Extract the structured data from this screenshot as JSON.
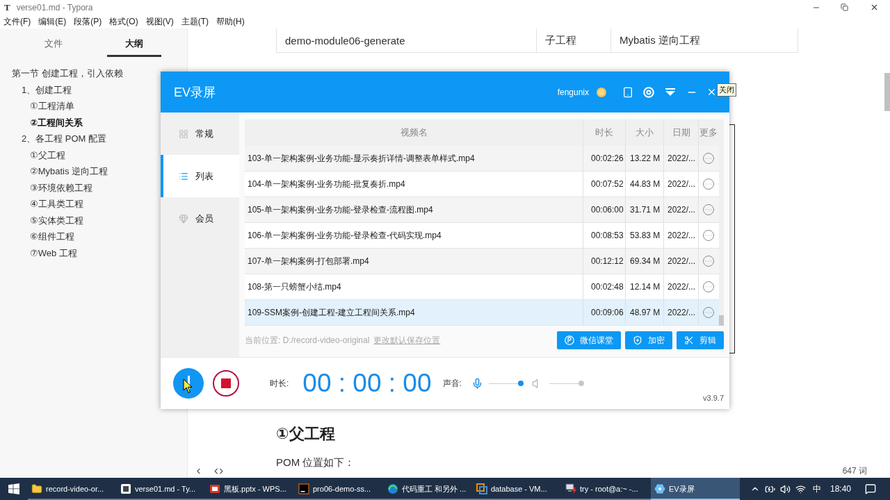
{
  "typora": {
    "app_letter": "T",
    "title": "verse01.md - Typora",
    "menu": [
      "文件(F)",
      "编辑(E)",
      "段落(P)",
      "格式(O)",
      "视图(V)",
      "主题(T)",
      "帮助(H)"
    ],
    "sidebar": {
      "tabs": [
        {
          "label": "文件",
          "selected": false
        },
        {
          "label": "大纲",
          "selected": true
        }
      ],
      "outline": [
        {
          "label": "第一节 创建工程，引入依赖",
          "selected": false,
          "children": [
            {
              "label": "1、创建工程",
              "selected": false,
              "children": [
                {
                  "label": "①工程清单",
                  "selected": false
                },
                {
                  "label": "②工程间关系",
                  "selected": true
                }
              ]
            },
            {
              "label": "2、各工程 POM 配置",
              "selected": false,
              "children": [
                {
                  "label": "①父工程",
                  "selected": false
                },
                {
                  "label": "②Mybatis 逆向工程",
                  "selected": false
                },
                {
                  "label": "③环境依赖工程",
                  "selected": false
                },
                {
                  "label": "④工具类工程",
                  "selected": false
                },
                {
                  "label": "⑤实体类工程",
                  "selected": false
                },
                {
                  "label": "⑥组件工程",
                  "selected": false
                },
                {
                  "label": "⑦Web 工程",
                  "selected": false
                }
              ]
            }
          ]
        }
      ]
    },
    "document": {
      "table_row": {
        "cells": [
          "demo-module06-generate",
          "子工程",
          "Mybatis 逆向工程"
        ]
      },
      "heading": "①父工程",
      "paragraph": "POM 位置如下："
    },
    "status_bar": {
      "word_count": "647 词"
    }
  },
  "ev_recorder": {
    "title": "EV录屏",
    "user": "fengunix",
    "close_tooltip": "关闭",
    "nav": [
      {
        "label": "常规",
        "selected": false
      },
      {
        "label": "列表",
        "selected": true
      },
      {
        "label": "会员",
        "selected": false
      }
    ],
    "table": {
      "columns": [
        "视频名",
        "时长",
        "大小",
        "日期",
        "更多"
      ],
      "rows": [
        {
          "name": "103-单一架构案例-业务功能-显示奏折详情-调整表单样式.mp4",
          "duration": "00:02:26",
          "size": "13.22 M",
          "date": "2022/...",
          "selected": false
        },
        {
          "name": "104-单一架构案例-业务功能-批复奏折.mp4",
          "duration": "00:07:52",
          "size": "44.83 M",
          "date": "2022/...",
          "selected": false
        },
        {
          "name": "105-单一架构案例-业务功能-登录检查-流程图.mp4",
          "duration": "00:06:00",
          "size": "31.71 M",
          "date": "2022/...",
          "selected": false
        },
        {
          "name": "106-单一架构案例-业务功能-登录检查-代码实现.mp4",
          "duration": "00:08:53",
          "size": "53.83 M",
          "date": "2022/...",
          "selected": false
        },
        {
          "name": "107-单一架构案例-打包部署.mp4",
          "duration": "00:12:12",
          "size": "69.34 M",
          "date": "2022/...",
          "selected": false
        },
        {
          "name": "108-第一只螃蟹小结.mp4",
          "duration": "00:02:48",
          "size": "12.14 M",
          "date": "2022/...",
          "selected": false
        },
        {
          "name": "109-SSM案例-创建工程-建立工程间关系.mp4",
          "duration": "00:09:06",
          "size": "48.97 M",
          "date": "2022/...",
          "selected": true
        }
      ]
    },
    "location": {
      "text": "当前位置: D:/record-video-original",
      "link": "更改默认保存位置"
    },
    "actions": [
      "微信课堂",
      "加密",
      "剪辑"
    ],
    "controls": {
      "duration_label": "时长:",
      "timer": "00 : 00 : 00",
      "sound_label": "声音:",
      "mic": {
        "enabled": true,
        "level": 1
      },
      "speaker": {
        "enabled": false,
        "level": 1
      }
    },
    "version": "v3.9.7"
  },
  "taskbar": {
    "items": [
      {
        "label": "record-video-or...",
        "selected": false
      },
      {
        "label": "verse01.md - Ty...",
        "selected": false
      },
      {
        "label": "黑板.pptx - WPS...",
        "selected": false
      },
      {
        "label": "pro06-demo-ss...",
        "selected": false
      },
      {
        "label": "代码重工 和另外 ...",
        "selected": false
      },
      {
        "label": "database - VM...",
        "selected": false
      },
      {
        "label": "try - root@a:~ -...",
        "selected": false
      },
      {
        "label": "EV录屏",
        "selected": true
      }
    ],
    "tray": {
      "input_method": "中",
      "time": "18:40"
    }
  }
}
